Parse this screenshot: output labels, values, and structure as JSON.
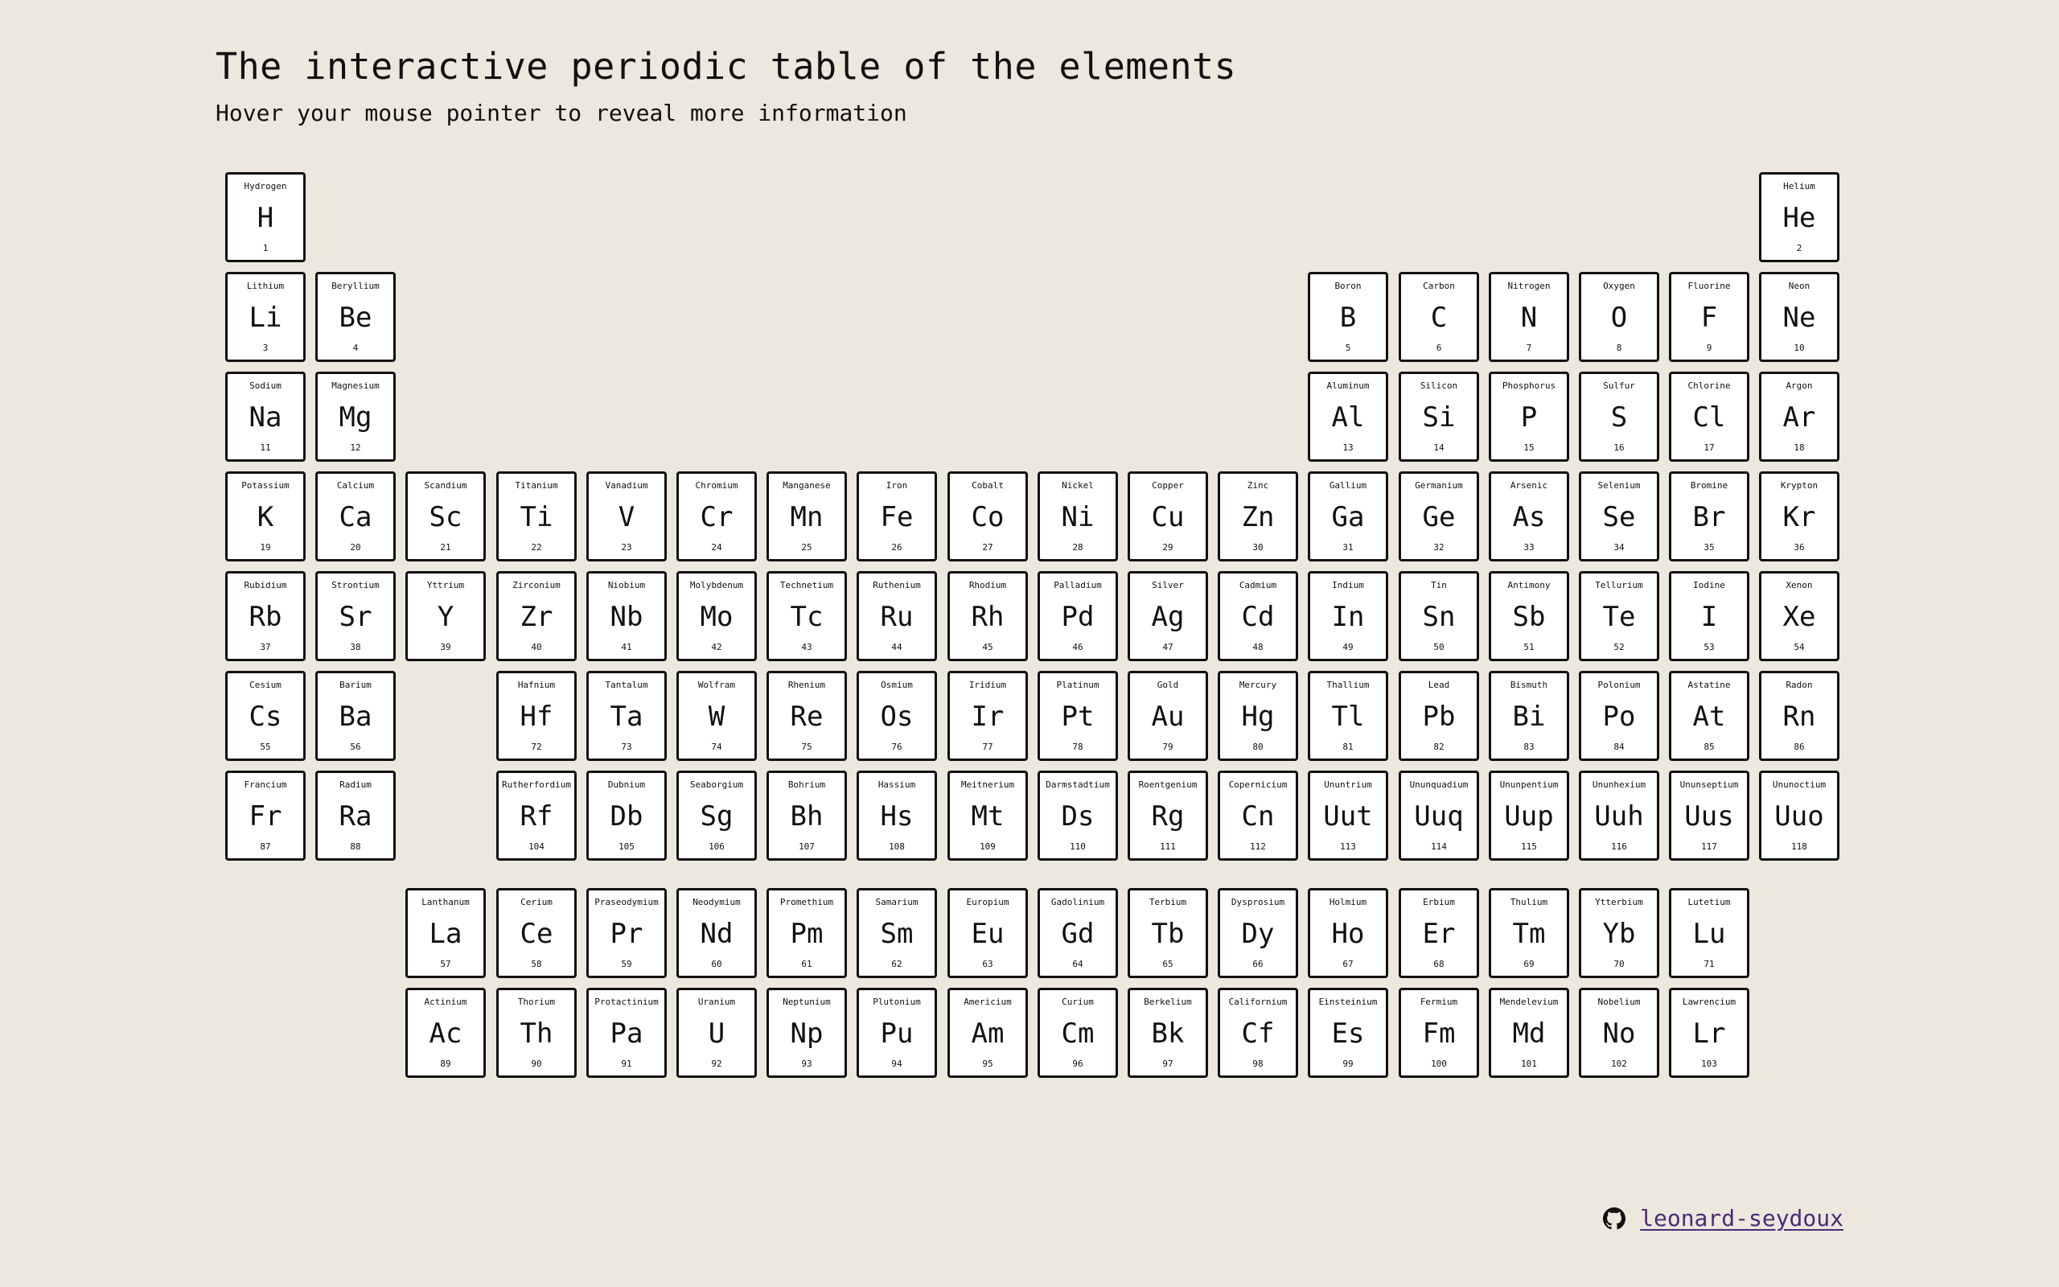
{
  "header": {
    "title": "The interactive periodic table of the elements",
    "subtitle": "Hover your mouse pointer to reveal more information"
  },
  "elements": [
    {
      "name": "Hydrogen",
      "symbol": "H",
      "number": "1"
    },
    {
      "name": "Helium",
      "symbol": "He",
      "number": "2"
    },
    {
      "name": "Lithium",
      "symbol": "Li",
      "number": "3"
    },
    {
      "name": "Beryllium",
      "symbol": "Be",
      "number": "4"
    },
    {
      "name": "Boron",
      "symbol": "B",
      "number": "5"
    },
    {
      "name": "Carbon",
      "symbol": "C",
      "number": "6"
    },
    {
      "name": "Nitrogen",
      "symbol": "N",
      "number": "7"
    },
    {
      "name": "Oxygen",
      "symbol": "O",
      "number": "8"
    },
    {
      "name": "Fluorine",
      "symbol": "F",
      "number": "9"
    },
    {
      "name": "Neon",
      "symbol": "Ne",
      "number": "10"
    },
    {
      "name": "Sodium",
      "symbol": "Na",
      "number": "11"
    },
    {
      "name": "Magnesium",
      "symbol": "Mg",
      "number": "12"
    },
    {
      "name": "Aluminum",
      "symbol": "Al",
      "number": "13"
    },
    {
      "name": "Silicon",
      "symbol": "Si",
      "number": "14"
    },
    {
      "name": "Phosphorus",
      "symbol": "P",
      "number": "15"
    },
    {
      "name": "Sulfur",
      "symbol": "S",
      "number": "16"
    },
    {
      "name": "Chlorine",
      "symbol": "Cl",
      "number": "17"
    },
    {
      "name": "Argon",
      "symbol": "Ar",
      "number": "18"
    },
    {
      "name": "Potassium",
      "symbol": "K",
      "number": "19"
    },
    {
      "name": "Calcium",
      "symbol": "Ca",
      "number": "20"
    },
    {
      "name": "Scandium",
      "symbol": "Sc",
      "number": "21"
    },
    {
      "name": "Titanium",
      "symbol": "Ti",
      "number": "22"
    },
    {
      "name": "Vanadium",
      "symbol": "V",
      "number": "23"
    },
    {
      "name": "Chromium",
      "symbol": "Cr",
      "number": "24"
    },
    {
      "name": "Manganese",
      "symbol": "Mn",
      "number": "25"
    },
    {
      "name": "Iron",
      "symbol": "Fe",
      "number": "26"
    },
    {
      "name": "Cobalt",
      "symbol": "Co",
      "number": "27"
    },
    {
      "name": "Nickel",
      "symbol": "Ni",
      "number": "28"
    },
    {
      "name": "Copper",
      "symbol": "Cu",
      "number": "29"
    },
    {
      "name": "Zinc",
      "symbol": "Zn",
      "number": "30"
    },
    {
      "name": "Gallium",
      "symbol": "Ga",
      "number": "31"
    },
    {
      "name": "Germanium",
      "symbol": "Ge",
      "number": "32"
    },
    {
      "name": "Arsenic",
      "symbol": "As",
      "number": "33"
    },
    {
      "name": "Selenium",
      "symbol": "Se",
      "number": "34"
    },
    {
      "name": "Bromine",
      "symbol": "Br",
      "number": "35"
    },
    {
      "name": "Krypton",
      "symbol": "Kr",
      "number": "36"
    },
    {
      "name": "Rubidium",
      "symbol": "Rb",
      "number": "37"
    },
    {
      "name": "Strontium",
      "symbol": "Sr",
      "number": "38"
    },
    {
      "name": "Yttrium",
      "symbol": "Y",
      "number": "39"
    },
    {
      "name": "Zirconium",
      "symbol": "Zr",
      "number": "40"
    },
    {
      "name": "Niobium",
      "symbol": "Nb",
      "number": "41"
    },
    {
      "name": "Molybdenum",
      "symbol": "Mo",
      "number": "42"
    },
    {
      "name": "Technetium",
      "symbol": "Tc",
      "number": "43"
    },
    {
      "name": "Ruthenium",
      "symbol": "Ru",
      "number": "44"
    },
    {
      "name": "Rhodium",
      "symbol": "Rh",
      "number": "45"
    },
    {
      "name": "Palladium",
      "symbol": "Pd",
      "number": "46"
    },
    {
      "name": "Silver",
      "symbol": "Ag",
      "number": "47"
    },
    {
      "name": "Cadmium",
      "symbol": "Cd",
      "number": "48"
    },
    {
      "name": "Indium",
      "symbol": "In",
      "number": "49"
    },
    {
      "name": "Tin",
      "symbol": "Sn",
      "number": "50"
    },
    {
      "name": "Antimony",
      "symbol": "Sb",
      "number": "51"
    },
    {
      "name": "Tellurium",
      "symbol": "Te",
      "number": "52"
    },
    {
      "name": "Iodine",
      "symbol": "I",
      "number": "53"
    },
    {
      "name": "Xenon",
      "symbol": "Xe",
      "number": "54"
    },
    {
      "name": "Cesium",
      "symbol": "Cs",
      "number": "55"
    },
    {
      "name": "Barium",
      "symbol": "Ba",
      "number": "56"
    },
    {
      "name": "Lanthanum",
      "symbol": "La",
      "number": "57"
    },
    {
      "name": "Cerium",
      "symbol": "Ce",
      "number": "58"
    },
    {
      "name": "Praseodymium",
      "symbol": "Pr",
      "number": "59"
    },
    {
      "name": "Neodymium",
      "symbol": "Nd",
      "number": "60"
    },
    {
      "name": "Promethium",
      "symbol": "Pm",
      "number": "61"
    },
    {
      "name": "Samarium",
      "symbol": "Sm",
      "number": "62"
    },
    {
      "name": "Europium",
      "symbol": "Eu",
      "number": "63"
    },
    {
      "name": "Gadolinium",
      "symbol": "Gd",
      "number": "64"
    },
    {
      "name": "Terbium",
      "symbol": "Tb",
      "number": "65"
    },
    {
      "name": "Dysprosium",
      "symbol": "Dy",
      "number": "66"
    },
    {
      "name": "Holmium",
      "symbol": "Ho",
      "number": "67"
    },
    {
      "name": "Erbium",
      "symbol": "Er",
      "number": "68"
    },
    {
      "name": "Thulium",
      "symbol": "Tm",
      "number": "69"
    },
    {
      "name": "Ytterbium",
      "symbol": "Yb",
      "number": "70"
    },
    {
      "name": "Lutetium",
      "symbol": "Lu",
      "number": "71"
    },
    {
      "name": "Hafnium",
      "symbol": "Hf",
      "number": "72"
    },
    {
      "name": "Tantalum",
      "symbol": "Ta",
      "number": "73"
    },
    {
      "name": "Wolfram",
      "symbol": "W",
      "number": "74"
    },
    {
      "name": "Rhenium",
      "symbol": "Re",
      "number": "75"
    },
    {
      "name": "Osmium",
      "symbol": "Os",
      "number": "76"
    },
    {
      "name": "Iridium",
      "symbol": "Ir",
      "number": "77"
    },
    {
      "name": "Platinum",
      "symbol": "Pt",
      "number": "78"
    },
    {
      "name": "Gold",
      "symbol": "Au",
      "number": "79"
    },
    {
      "name": "Mercury",
      "symbol": "Hg",
      "number": "80"
    },
    {
      "name": "Thallium",
      "symbol": "Tl",
      "number": "81"
    },
    {
      "name": "Lead",
      "symbol": "Pb",
      "number": "82"
    },
    {
      "name": "Bismuth",
      "symbol": "Bi",
      "number": "83"
    },
    {
      "name": "Polonium",
      "symbol": "Po",
      "number": "84"
    },
    {
      "name": "Astatine",
      "symbol": "At",
      "number": "85"
    },
    {
      "name": "Radon",
      "symbol": "Rn",
      "number": "86"
    },
    {
      "name": "Francium",
      "symbol": "Fr",
      "number": "87"
    },
    {
      "name": "Radium",
      "symbol": "Ra",
      "number": "88"
    },
    {
      "name": "Actinium",
      "symbol": "Ac",
      "number": "89"
    },
    {
      "name": "Thorium",
      "symbol": "Th",
      "number": "90"
    },
    {
      "name": "Protactinium",
      "symbol": "Pa",
      "number": "91"
    },
    {
      "name": "Uranium",
      "symbol": "U",
      "number": "92"
    },
    {
      "name": "Neptunium",
      "symbol": "Np",
      "number": "93"
    },
    {
      "name": "Plutonium",
      "symbol": "Pu",
      "number": "94"
    },
    {
      "name": "Americium",
      "symbol": "Am",
      "number": "95"
    },
    {
      "name": "Curium",
      "symbol": "Cm",
      "number": "96"
    },
    {
      "name": "Berkelium",
      "symbol": "Bk",
      "number": "97"
    },
    {
      "name": "Californium",
      "symbol": "Cf",
      "number": "98"
    },
    {
      "name": "Einsteinium",
      "symbol": "Es",
      "number": "99"
    },
    {
      "name": "Fermium",
      "symbol": "Fm",
      "number": "100"
    },
    {
      "name": "Mendelevium",
      "symbol": "Md",
      "number": "101"
    },
    {
      "name": "Nobelium",
      "symbol": "No",
      "number": "102"
    },
    {
      "name": "Lawrencium",
      "symbol": "Lr",
      "number": "103"
    },
    {
      "name": "Rutherfordium",
      "symbol": "Rf",
      "number": "104"
    },
    {
      "name": "Dubnium",
      "symbol": "Db",
      "number": "105"
    },
    {
      "name": "Seaborgium",
      "symbol": "Sg",
      "number": "106"
    },
    {
      "name": "Bohrium",
      "symbol": "Bh",
      "number": "107"
    },
    {
      "name": "Hassium",
      "symbol": "Hs",
      "number": "108"
    },
    {
      "name": "Meitnerium",
      "symbol": "Mt",
      "number": "109"
    },
    {
      "name": "Darmstadtium",
      "symbol": "Ds",
      "number": "110"
    },
    {
      "name": "Roentgenium",
      "symbol": "Rg",
      "number": "111"
    },
    {
      "name": "Copernicium",
      "symbol": "Cn",
      "number": "112"
    },
    {
      "name": "Ununtrium",
      "symbol": "Uut",
      "number": "113"
    },
    {
      "name": "Ununquadium",
      "symbol": "Uuq",
      "number": "114"
    },
    {
      "name": "Ununpentium",
      "symbol": "Uup",
      "number": "115"
    },
    {
      "name": "Ununhexium",
      "symbol": "Uuh",
      "number": "116"
    },
    {
      "name": "Ununseptium",
      "symbol": "Uus",
      "number": "117"
    },
    {
      "name": "Ununoctium",
      "symbol": "Uuo",
      "number": "118"
    }
  ],
  "footer": {
    "icon": "github-icon",
    "link_text": "leonard-seydoux"
  },
  "colors": {
    "background": "#ece8dd",
    "tile": "#ffffff",
    "border": "#111111",
    "link": "#4b2a7b"
  }
}
